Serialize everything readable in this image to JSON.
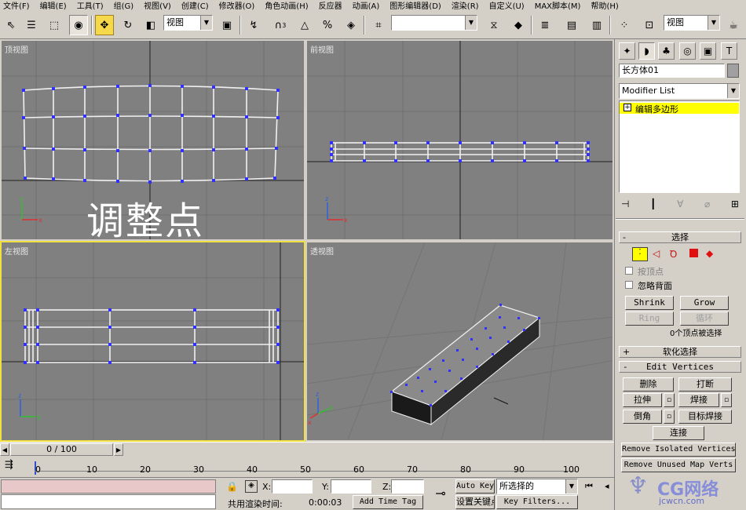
{
  "menu": [
    "文件(F)",
    "编辑(E)",
    "工具(T)",
    "组(G)",
    "视图(V)",
    "创建(C)",
    "修改器(O)",
    "角色动画(H)",
    "反应器",
    "动画(A)",
    "图形编辑器(D)",
    "渲染(R)",
    "自定义(U)",
    "MAX脚本(M)",
    "帮助(H)"
  ],
  "toolbar": {
    "view_combo": "视图",
    "named_sel_combo": "",
    "ref_coord_combo": "视图",
    "snap_label": "3"
  },
  "viewports": {
    "top": {
      "label": "顶视图",
      "annotation": "调整点"
    },
    "front": {
      "label": "前视图"
    },
    "left": {
      "label": "左视图"
    },
    "perspective": {
      "label": "透视图"
    }
  },
  "axes": {
    "x": "x",
    "y": "y",
    "z": "z"
  },
  "timeslider": {
    "position": "0 / 100"
  },
  "track": {
    "ticks": [
      "0",
      "10",
      "20",
      "30",
      "40",
      "50",
      "60",
      "70",
      "80",
      "90",
      "100"
    ]
  },
  "status": {
    "x_label": "X:",
    "y_label": "Y:",
    "z_label": "Z:",
    "x_value": "",
    "y_value": "",
    "z_value": "",
    "render_time_label": "共用渲染时间:",
    "render_time_value": "0:00:03",
    "add_time_tag": "Add Time Tag",
    "auto_key": "Auto Key",
    "selected_combo": "所选择的",
    "set_key": "设置关键点",
    "key_filters": "Key Filters..."
  },
  "command_panel": {
    "object_name": "长方体01",
    "modifier_list": "Modifier List",
    "stack_item": "编辑多边形",
    "selection_rollout": {
      "title": "选择",
      "by_vertex": "按顶点",
      "ignore_backfacing": "忽略背面",
      "shrink": "Shrink",
      "grow": "Grow",
      "ring": "Ring",
      "loop": "循环",
      "status": "0个顶点被选择"
    },
    "soft_selection": "软化选择",
    "edit_vertices": {
      "title": "Edit Vertices",
      "remove": "删除",
      "break": "打断",
      "extrude": "拉伸",
      "weld": "焊接",
      "chamfer": "倒角",
      "target_weld": "目标焊接",
      "connect": "连接",
      "remove_isolated": "Remove Isolated Vertices",
      "remove_unused": "Remove Unused Map Verts"
    }
  },
  "watermark": {
    "text": "CG网络",
    "url": "jcwcn.com"
  },
  "colors": {
    "viewport_bg": "#808080",
    "grid": "#707070",
    "vertex": "#3030ff",
    "selected_stack": "#ffff00",
    "active_border": "#f0e040"
  }
}
